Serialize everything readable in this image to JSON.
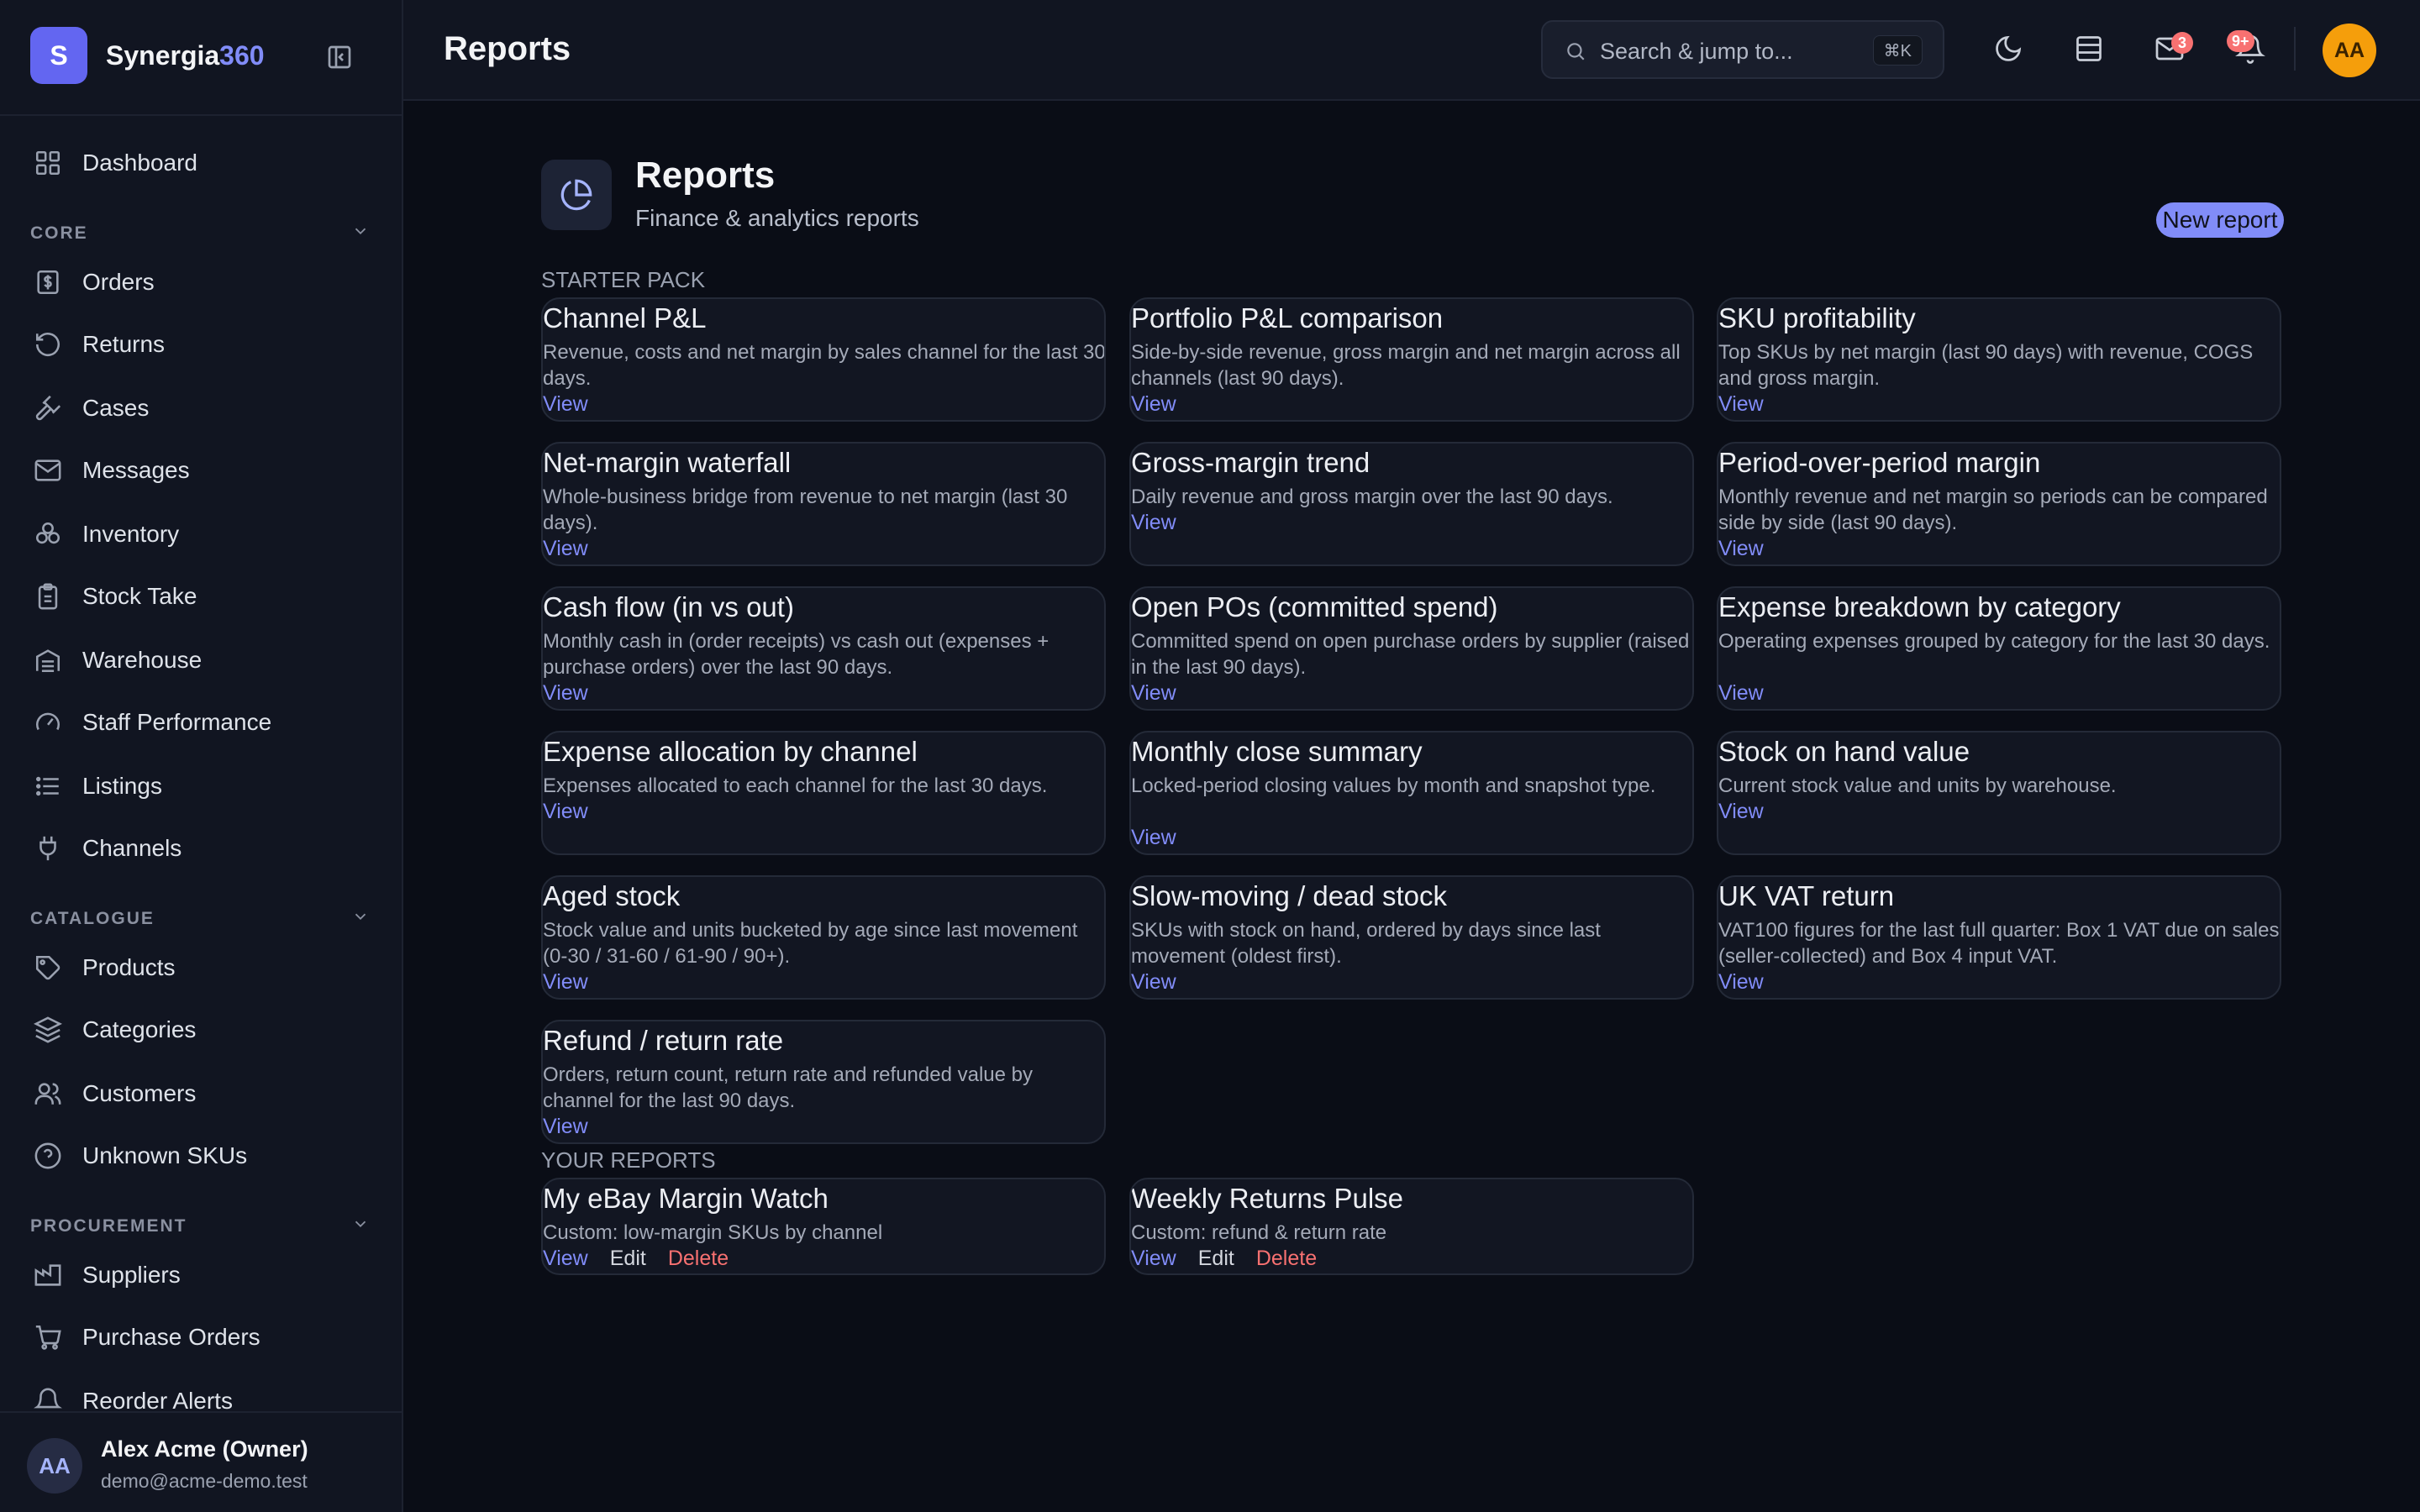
{
  "app": {
    "logo_letter": "S",
    "name_main": "Synergia",
    "name_accent": "360"
  },
  "sidebar": {
    "dashboard": "Dashboard",
    "sections": {
      "core": "CORE",
      "catalogue": "CATALOGUE",
      "procurement": "PROCUREMENT"
    },
    "core_items": [
      "Orders",
      "Returns",
      "Cases",
      "Messages",
      "Inventory",
      "Stock Take",
      "Warehouse",
      "Staff Performance",
      "Listings",
      "Channels"
    ],
    "catalogue_items": [
      "Products",
      "Categories",
      "Customers",
      "Unknown SKUs"
    ],
    "procurement_items": [
      "Suppliers",
      "Purchase Orders",
      "Reorder Alerts"
    ],
    "user": {
      "initials": "AA",
      "name": "Alex Acme (Owner)",
      "email": "demo@acme-demo.test"
    }
  },
  "topbar": {
    "title": "Reports",
    "search_placeholder": "Search & jump to...",
    "search_shortcut": "⌘K",
    "mail_badge": "3",
    "notif_badge": "9+",
    "avatar_initials": "AA"
  },
  "page": {
    "heading": "Reports",
    "subtitle": "Finance & analytics reports",
    "new_report_label": "New report",
    "starter_label": "STARTER PACK",
    "your_label": "YOUR REPORTS"
  },
  "actions": {
    "view": "View",
    "edit": "Edit",
    "delete": "Delete"
  },
  "starter_reports": [
    {
      "title": "Channel P&L",
      "desc": "Revenue, costs and net margin by sales channel for the last 30 days."
    },
    {
      "title": "Portfolio P&L comparison",
      "desc": "Side-by-side revenue, gross margin and net margin across all channels (last 90 days)."
    },
    {
      "title": "SKU profitability",
      "desc": "Top SKUs by net margin (last 90 days) with revenue, COGS and gross margin."
    },
    {
      "title": "Net-margin waterfall",
      "desc": "Whole-business bridge from revenue to net margin (last 30 days)."
    },
    {
      "title": "Gross-margin trend",
      "desc": "Daily revenue and gross margin over the last 90 days."
    },
    {
      "title": "Period-over-period margin",
      "desc": "Monthly revenue and net margin so periods can be compared side by side (last 90 days)."
    },
    {
      "title": "Cash flow (in vs out)",
      "desc": "Monthly cash in (order receipts) vs cash out (expenses + purchase orders) over the last 90 days."
    },
    {
      "title": "Open POs (committed spend)",
      "desc": "Committed spend on open purchase orders by supplier (raised in the last 90 days)."
    },
    {
      "title": "Expense breakdown by category",
      "desc": "Operating expenses grouped by category for the last 30 days."
    },
    {
      "title": "Expense allocation by channel",
      "desc": "Expenses allocated to each channel for the last 30 days."
    },
    {
      "title": "Monthly close summary",
      "desc": "Locked-period closing values by month and snapshot type."
    },
    {
      "title": "Stock on hand value",
      "desc": "Current stock value and units by warehouse."
    },
    {
      "title": "Aged stock",
      "desc": "Stock value and units bucketed by age since last movement (0-30 / 31-60 / 61-90 / 90+)."
    },
    {
      "title": "Slow-moving / dead stock",
      "desc": "SKUs with stock on hand, ordered by days since last movement (oldest first)."
    },
    {
      "title": "UK VAT return",
      "desc": "VAT100 figures for the last full quarter: Box 1 VAT due on sales (seller-collected) and Box 4 input VAT."
    },
    {
      "title": "Refund / return rate",
      "desc": "Orders, return count, return rate and refunded value by channel for the last 90 days."
    }
  ],
  "your_reports": [
    {
      "title": "My eBay Margin Watch",
      "desc": "Custom: low-margin SKUs by channel"
    },
    {
      "title": "Weekly Returns Pulse",
      "desc": "Custom: refund & return rate"
    }
  ],
  "colors": {
    "accent": "#818cf8",
    "danger": "#f87171",
    "avatar": "#f59e0b",
    "background": "#0a0d16",
    "panel": "#111521"
  }
}
